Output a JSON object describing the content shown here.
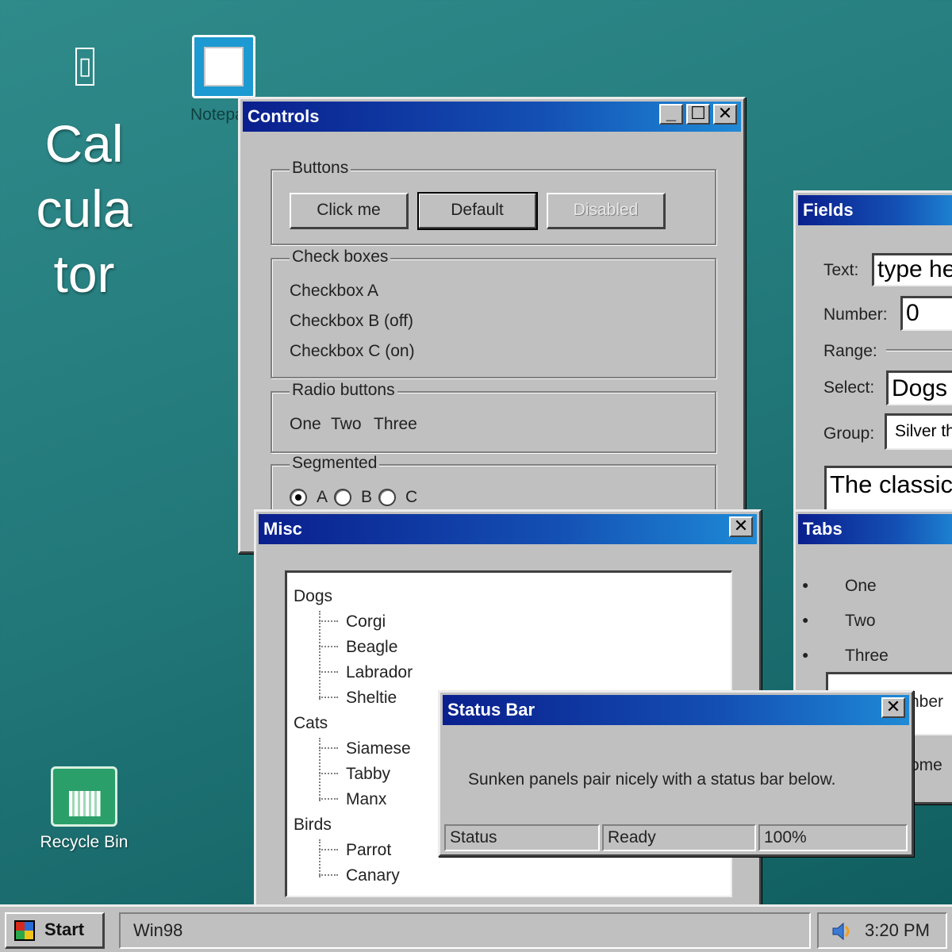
{
  "desktop": {
    "calculator_label": "Cal\ncula\ntor",
    "notepad_label": "Notepad",
    "recycle_label": "Recycle Bin"
  },
  "controls": {
    "title": "Controls",
    "buttons_legend": "Buttons",
    "btn_click": "Click me",
    "btn_default": "Default",
    "btn_disabled": "Disabled",
    "checkboxes_legend": "Check boxes",
    "checkbox_a": "Checkbox A",
    "checkbox_b": "Checkbox B (off)",
    "checkbox_c": "Checkbox C (on)",
    "radio_legend": "Radio buttons",
    "radio_one": "One",
    "radio_two": "Two",
    "radio_three": "Three",
    "segmented_legend": "Segmented",
    "seg_a": "A",
    "seg_b": "B",
    "seg_c": "C",
    "segmented_selected": "A"
  },
  "fields": {
    "title": "Fields",
    "text_label": "Text:",
    "text_value": "type here",
    "number_label": "Number:",
    "number_value": "0",
    "range_label": "Range:",
    "select_label": "Select:",
    "select_value": "Dogs",
    "group_label": "Group:",
    "group_value": "Silver the",
    "textarea_value": "The classic"
  },
  "tabs": {
    "title": "Tabs",
    "items": [
      "One",
      "Two",
      "Three"
    ],
    "partial_1": "nber",
    "partial_2": "ome"
  },
  "misc": {
    "title": "Misc",
    "tree": [
      {
        "label": "Dogs",
        "children": [
          "Corgi",
          "Beagle",
          "Labrador",
          "Sheltie"
        ]
      },
      {
        "label": "Cats",
        "children": [
          "Siamese",
          "Tabby",
          "Manx"
        ]
      },
      {
        "label": "Birds",
        "children": [
          "Parrot",
          "Canary"
        ]
      }
    ]
  },
  "statusbar": {
    "title": "Status Bar",
    "message": "Sunken panels pair nicely with a status bar below.",
    "cells": [
      "Status",
      "Ready",
      "100%"
    ]
  },
  "taskbar": {
    "start_label": "Start",
    "task_label": "Win98",
    "clock": "3:20 PM"
  },
  "colors": {
    "titlebar_start": "#0a1f8e",
    "titlebar_end": "#1e8ad6",
    "window_face": "#c0c0c0",
    "desktop": "#23797a"
  }
}
